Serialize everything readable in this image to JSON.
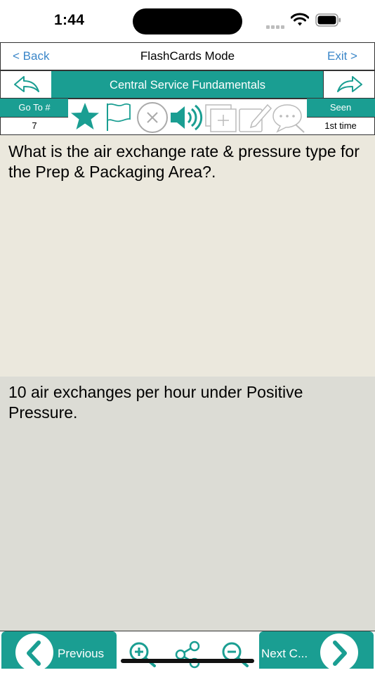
{
  "status_bar": {
    "time": "1:44"
  },
  "nav": {
    "back_label": "< Back",
    "title": "FlashCards Mode",
    "exit_label": "Exit >"
  },
  "category": {
    "title": "Central Service Fundamentals"
  },
  "goto": {
    "label": "Go To #",
    "value": "7"
  },
  "seen": {
    "label": "Seen",
    "value": "1st time"
  },
  "toolbar": {
    "icons": [
      "star-icon",
      "flag-icon",
      "close-circle-icon",
      "speaker-icon",
      "add-card-icon",
      "edit-icon",
      "comment-icon"
    ]
  },
  "card": {
    "question": "What is the air exchange rate & pressure type for the Prep & Packaging Area?.",
    "answer": "10 air exchanges per hour under Positive Pressure."
  },
  "bottom": {
    "previous_label": "Previous",
    "next_label": "Next C..."
  },
  "colors": {
    "teal": "#1a9e92",
    "question_bg": "#ebe8dd",
    "answer_bg": "#dcdcd5",
    "link": "#3a86c8"
  }
}
